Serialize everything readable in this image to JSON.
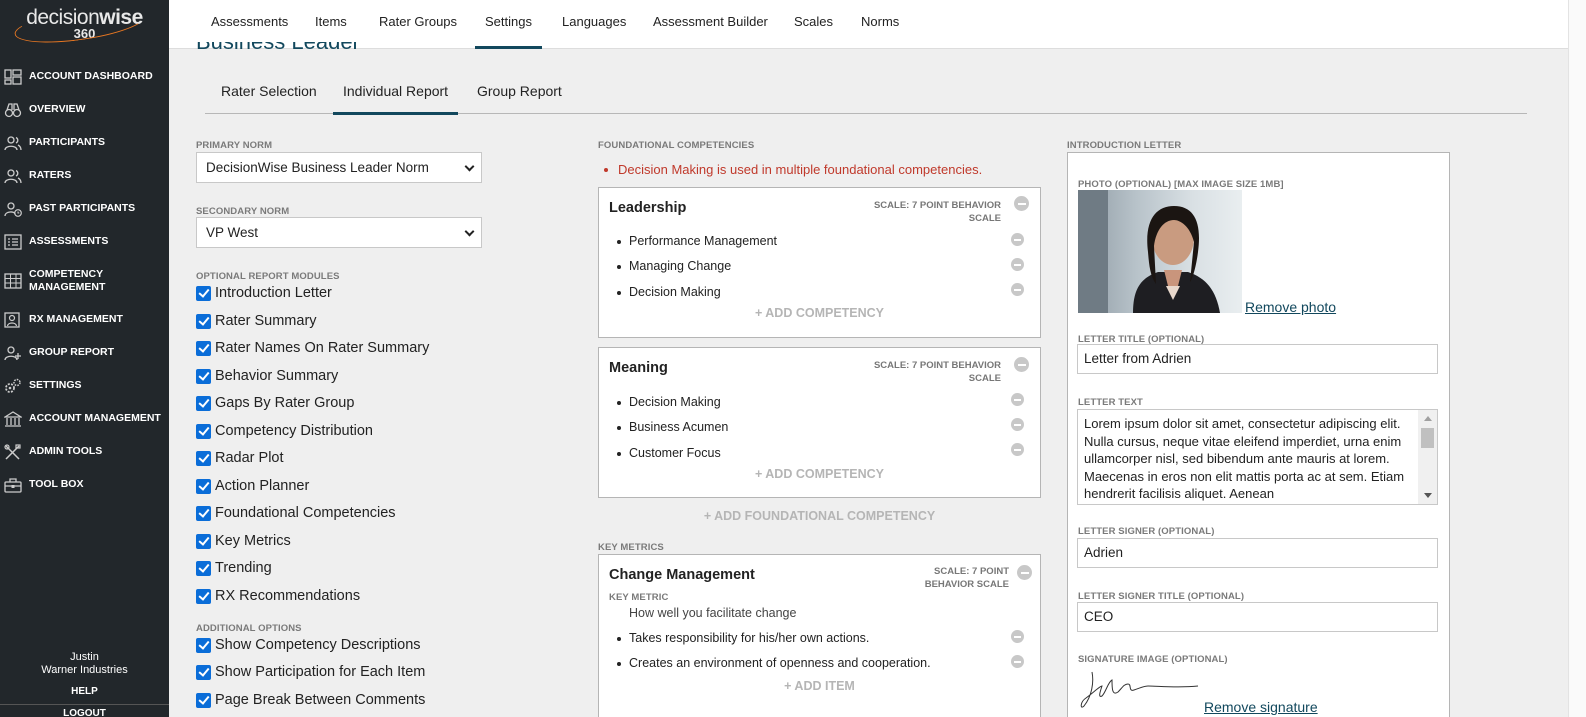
{
  "sidebar": {
    "logo": {
      "word1": "decision",
      "word2": "wise",
      "number": "360"
    },
    "items": [
      {
        "label": "ACCOUNT DASHBOARD",
        "icon": "dashboard-icon"
      },
      {
        "label": "OVERVIEW",
        "icon": "binoculars-icon"
      },
      {
        "label": "PARTICIPANTS",
        "icon": "users-icon"
      },
      {
        "label": "RATERS",
        "icon": "users-icon"
      },
      {
        "label": "PAST PARTICIPANTS",
        "icon": "users-clock-icon"
      },
      {
        "label": "ASSESSMENTS",
        "icon": "list-icon"
      },
      {
        "label": "COMPETENCY MANAGEMENT",
        "icon": "grid-icon"
      },
      {
        "label": "RX MANAGEMENT",
        "icon": "user-rx-icon"
      },
      {
        "label": "GROUP REPORT",
        "icon": "group-icon"
      },
      {
        "label": "SETTINGS",
        "icon": "gears-icon"
      },
      {
        "label": "ACCOUNT MANAGEMENT",
        "icon": "building-icon"
      },
      {
        "label": "ADMIN TOOLS",
        "icon": "tools-icon"
      },
      {
        "label": "TOOL BOX",
        "icon": "toolbox-icon"
      }
    ],
    "user_name": "Justin",
    "company": "Warner Industries",
    "help": "HELP",
    "logout": "LOGOUT"
  },
  "topnav": {
    "tabs": [
      "Assessments",
      "Items",
      "Rater Groups",
      "Settings",
      "Languages",
      "Assessment Builder",
      "Scales",
      "Norms"
    ],
    "active": "Settings"
  },
  "page_title": "Business Leader",
  "subtabs": {
    "items": [
      "Rater Selection",
      "Individual Report",
      "Group Report"
    ],
    "active": "Individual Report"
  },
  "left": {
    "primary_norm_label": "PRIMARY NORM",
    "primary_norm_value": "DecisionWise Business Leader Norm",
    "secondary_norm_label": "SECONDARY NORM",
    "secondary_norm_value": "VP West",
    "modules_label": "OPTIONAL REPORT MODULES",
    "modules": [
      "Introduction Letter",
      "Rater Summary",
      "Rater Names On Rater Summary",
      "Behavior Summary",
      "Gaps By Rater Group",
      "Competency Distribution",
      "Radar Plot",
      "Action Planner",
      "Foundational Competencies",
      "Key Metrics",
      "Trending",
      "RX Recommendations"
    ],
    "additional_label": "ADDITIONAL OPTIONS",
    "additional": [
      "Show Competency Descriptions",
      "Show Participation for Each Item",
      "Page Break Between Comments"
    ]
  },
  "middle": {
    "foundational_label": "FOUNDATIONAL COMPETENCIES",
    "warning": "Decision Making is used in multiple foundational competencies.",
    "cards": [
      {
        "title": "Leadership",
        "scale": "SCALE: 7 POINT BEHAVIOR SCALE",
        "items": [
          "Performance Management",
          "Managing Change",
          "Decision Making"
        ],
        "add": "+ ADD COMPETENCY"
      },
      {
        "title": "Meaning",
        "scale": "SCALE: 7 POINT BEHAVIOR SCALE",
        "items": [
          "Decision Making",
          "Business Acumen",
          "Customer Focus"
        ],
        "add": "+ ADD COMPETENCY"
      }
    ],
    "add_foundational": "+ ADD FOUNDATIONAL COMPETENCY",
    "key_metrics_label": "KEY METRICS",
    "metric": {
      "title": "Change Management",
      "scale": "SCALE: 7 POINT BEHAVIOR SCALE",
      "sub_label": "KEY METRIC",
      "description": "How well you facilitate change",
      "items": [
        "Takes responsibility for his/her own actions.",
        "Creates an environment of openness and cooperation."
      ],
      "add": "+ ADD ITEM"
    }
  },
  "right": {
    "intro_label": "INTRODUCTION LETTER",
    "photo_label": "PHOTO (OPTIONAL) [MAX IMAGE SIZE 1MB]",
    "remove_photo": "Remove photo",
    "letter_title_label": "LETTER TITLE (OPTIONAL)",
    "letter_title_value": "Letter from Adrien",
    "letter_text_label": "LETTER TEXT",
    "letter_text_value": "Lorem ipsum dolor sit amet, consectetur adipiscing elit. Nulla cursus, neque vitae eleifend imperdiet, urna enim ullamcorper nisl, sed bibendum ante mauris at lorem. Maecenas in eros non elit mattis porta ac at sem. Etiam hendrerit facilisis aliquet. Aenean",
    "signer_label": "LETTER SIGNER (OPTIONAL)",
    "signer_value": "Adrien",
    "signer_title_label": "LETTER SIGNER TITLE (OPTIONAL)",
    "signer_title_value": "CEO",
    "signature_label": "SIGNATURE IMAGE (OPTIONAL)",
    "remove_signature": "Remove signature"
  },
  "colors": {
    "accent": "#12485d",
    "sidebar_bg": "#22272b",
    "checkbox": "#0a6dd8",
    "warning": "#c0392b",
    "brand_orange": "#e87722"
  }
}
